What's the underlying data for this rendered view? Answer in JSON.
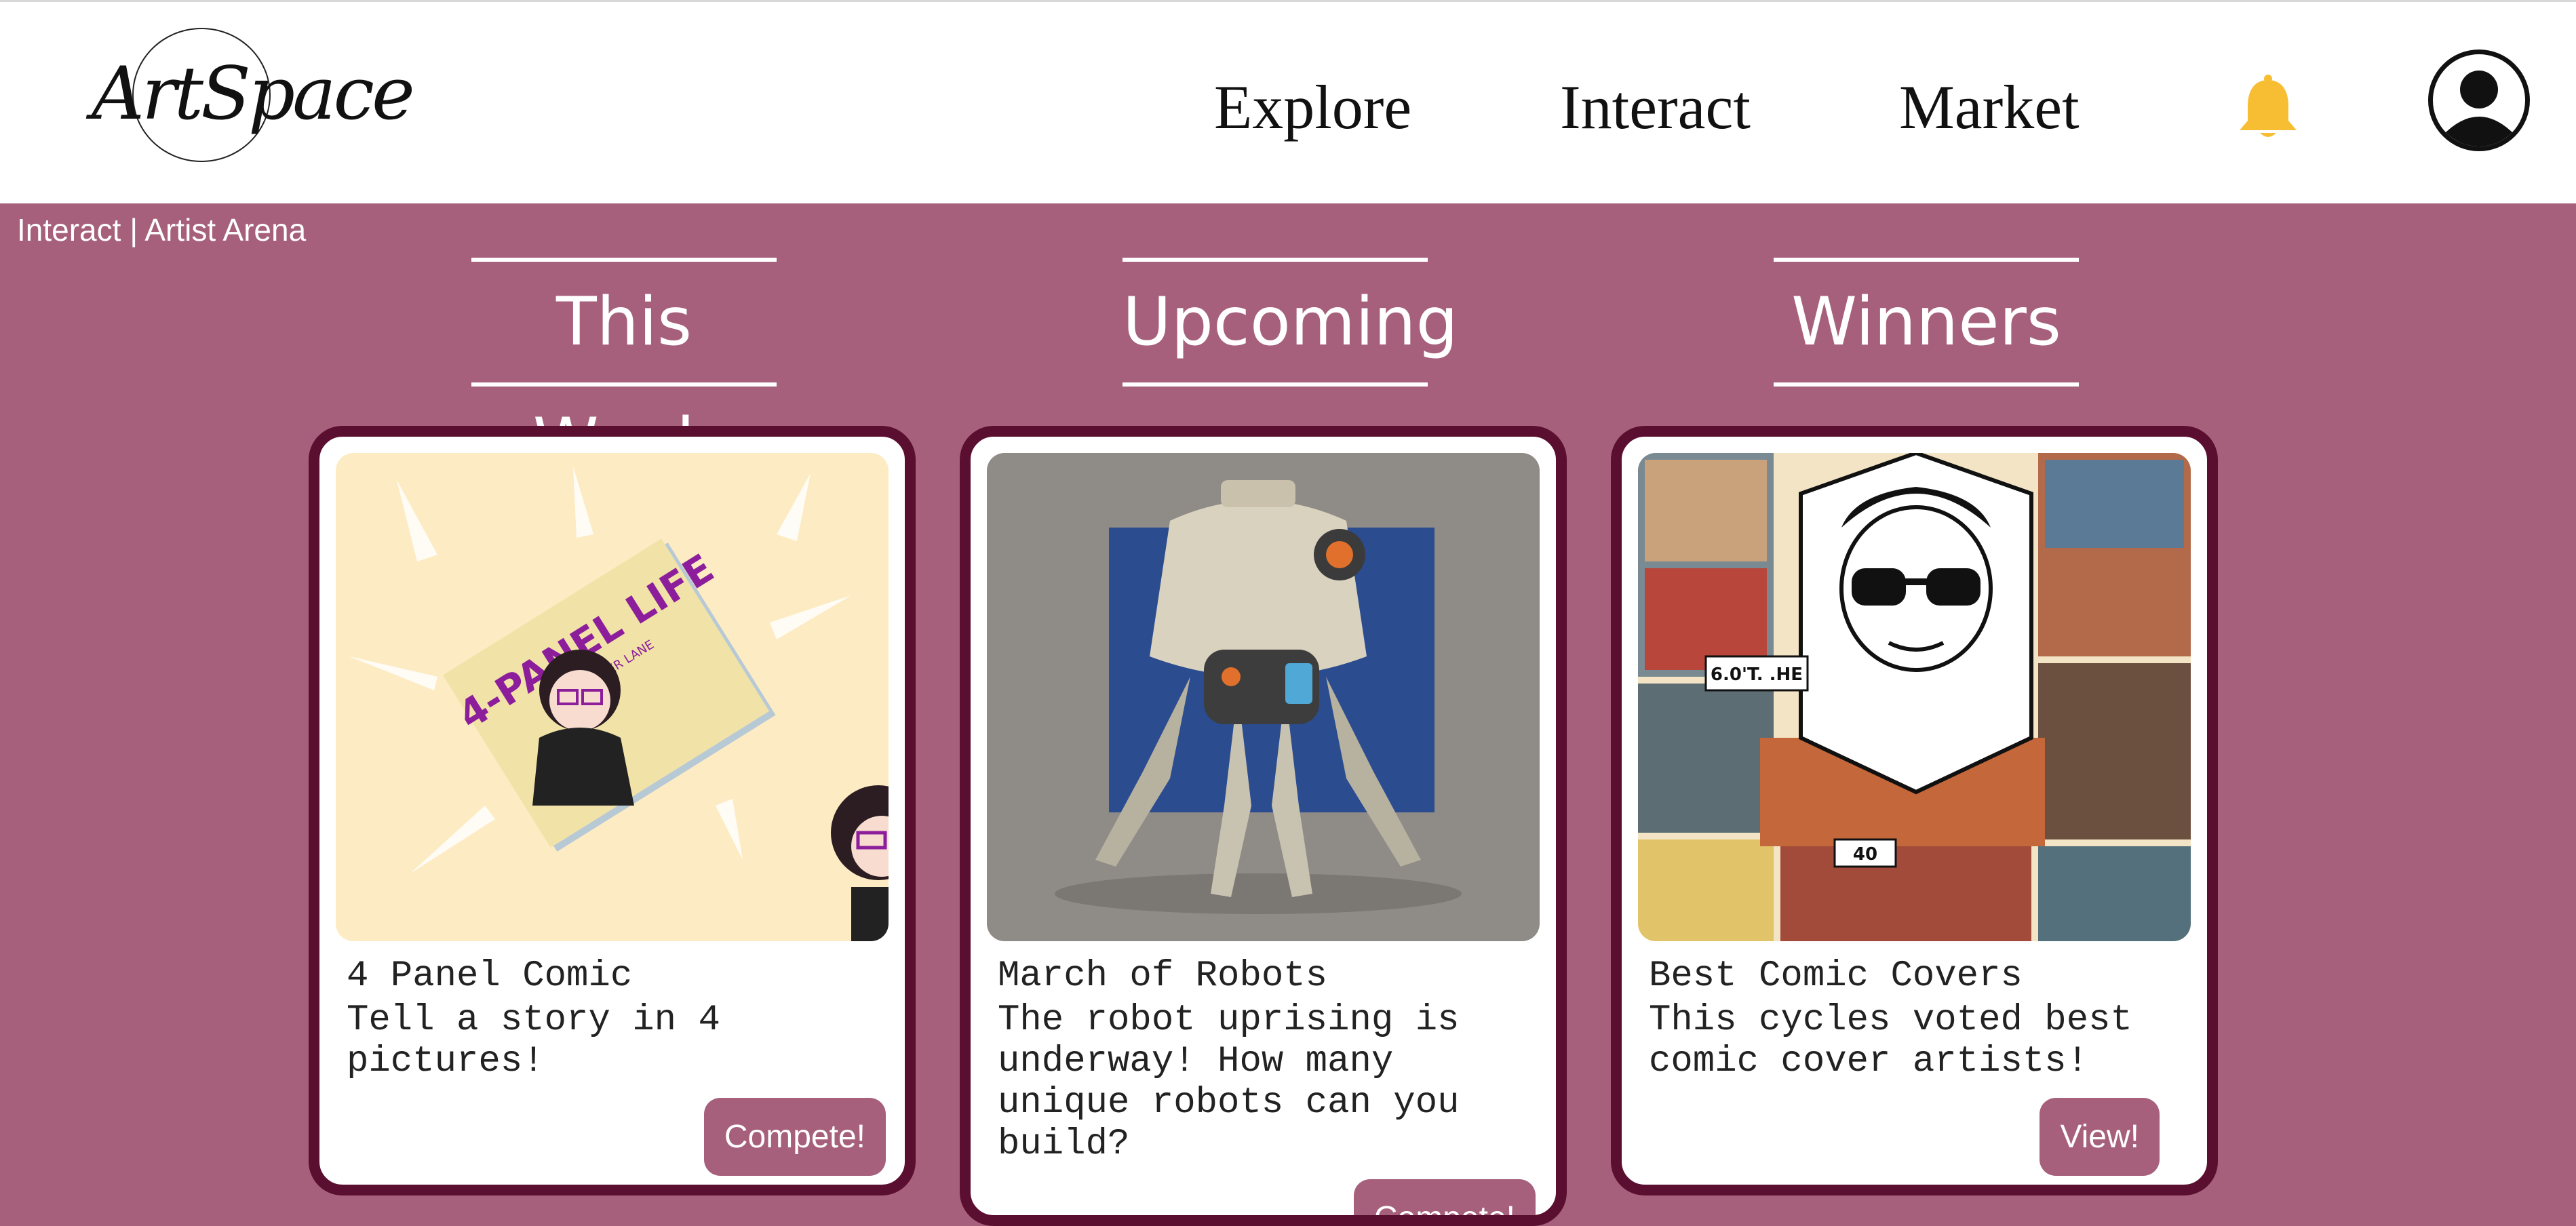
{
  "header": {
    "logo_text": "ArtSpace",
    "nav": [
      {
        "label": "Explore"
      },
      {
        "label": "Interact"
      },
      {
        "label": "Market"
      }
    ],
    "bell_color": "#f7be33"
  },
  "breadcrumb": "Interact | Artist Arena",
  "columns": [
    {
      "title": "This Week"
    },
    {
      "title": "Upcoming"
    },
    {
      "title": "Winners"
    }
  ],
  "cards": [
    {
      "title": "4 Panel Comic",
      "description": "Tell a story in 4 pictures!",
      "button": "Compete!",
      "image": {
        "book_title": "4-PANEL LIFE",
        "subtitle": "BY JENNIFER LANE"
      }
    },
    {
      "title": "March of Robots",
      "description": "The robot uprising is underway! How many unique robots can you build?",
      "button": "Compete!",
      "image": {}
    },
    {
      "title": "Best Comic Covers",
      "description": "This cycles voted best comic cover artists!",
      "button": "View!",
      "image": {
        "badge": "6.0'T. .HE",
        "badge2": "40"
      }
    }
  ],
  "colors": {
    "background": "#a6607b",
    "card_border": "#5a0f30",
    "button": "#a6607b"
  }
}
